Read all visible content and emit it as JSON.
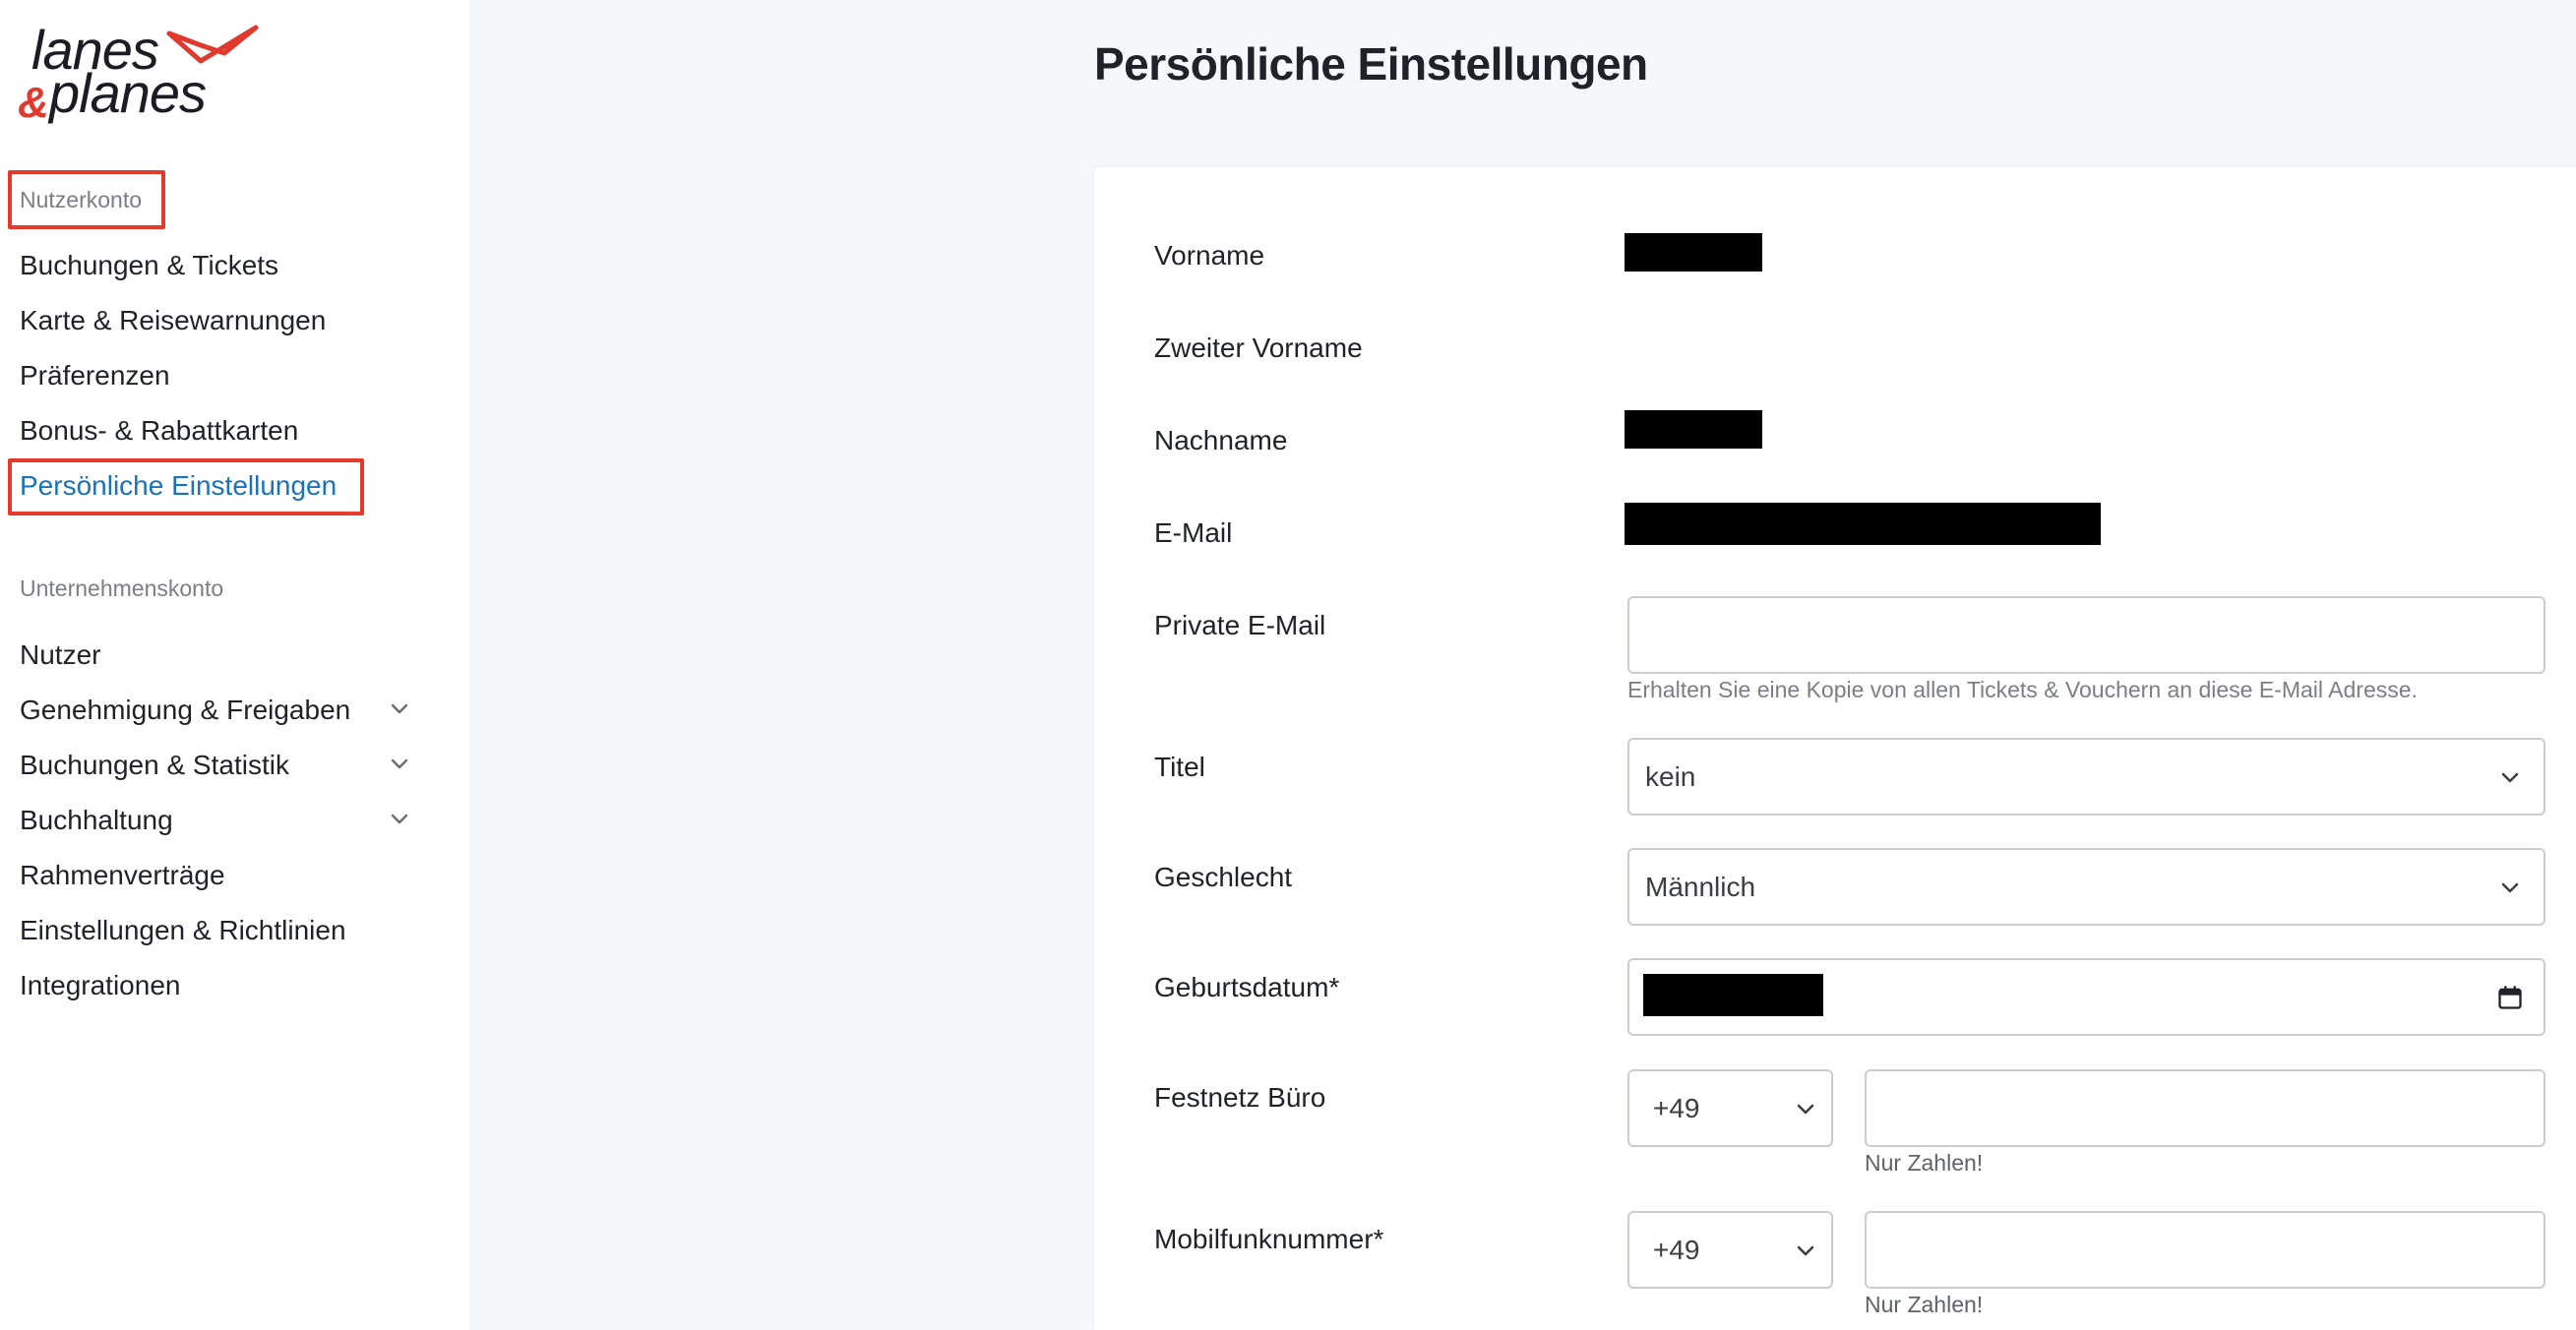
{
  "logo": {
    "line1": "lanes",
    "amp": "&",
    "line2": "planes"
  },
  "sidebar": {
    "section_user": "Nutzerkonto",
    "user_items": [
      {
        "label": "Buchungen & Tickets"
      },
      {
        "label": "Karte & Reisewarnungen"
      },
      {
        "label": "Präferenzen"
      },
      {
        "label": "Bonus- & Rabattkarten"
      },
      {
        "label": "Persönliche Einstellungen",
        "active": true
      }
    ],
    "section_company": "Unternehmenskonto",
    "company_items": [
      {
        "label": "Nutzer"
      },
      {
        "label": "Genehmigung & Freigaben",
        "expandable": true
      },
      {
        "label": "Buchungen & Statistik",
        "expandable": true
      },
      {
        "label": "Buchhaltung",
        "expandable": true
      },
      {
        "label": "Rahmenverträge"
      },
      {
        "label": "Einstellungen & Richtlinien"
      },
      {
        "label": "Integrationen"
      }
    ]
  },
  "main": {
    "title": "Persönliche Einstellungen",
    "fields": {
      "first_name": {
        "label": "Vorname"
      },
      "middle_name": {
        "label": "Zweiter Vorname"
      },
      "last_name": {
        "label": "Nachname"
      },
      "email": {
        "label": "E-Mail"
      },
      "private_email": {
        "label": "Private E-Mail",
        "value": "",
        "help": "Erhalten Sie eine Kopie von allen Tickets & Vouchern an diese E-Mail Adresse."
      },
      "title": {
        "label": "Titel",
        "value": "kein"
      },
      "gender": {
        "label": "Geschlecht",
        "value": "Männlich"
      },
      "birthdate": {
        "label": "Geburtsdatum*"
      },
      "landline": {
        "label": "Festnetz Büro",
        "prefix": "+49",
        "value": "",
        "help": "Nur Zahlen!"
      },
      "mobile": {
        "label": "Mobilfunknummer*",
        "prefix": "+49",
        "value": "",
        "help": "Nur Zahlen!"
      }
    }
  },
  "colors": {
    "accent": "#1a72b8",
    "highlight": "#e53a2b",
    "brand_red": "#e03a2e"
  }
}
